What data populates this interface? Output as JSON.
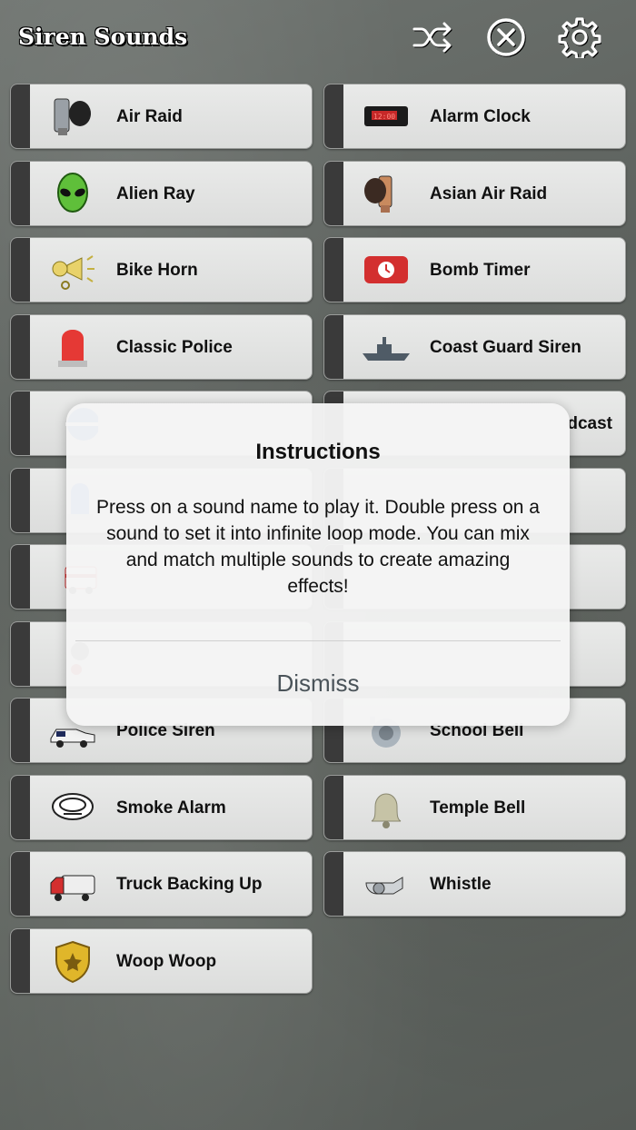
{
  "header": {
    "title": "Siren Sounds",
    "icons": [
      "shuffle-icon",
      "stop-circle-icon",
      "gear-icon"
    ]
  },
  "sounds": [
    {
      "label": "Air Raid",
      "icon": "air-raid-siren-icon"
    },
    {
      "label": "Alarm Clock",
      "icon": "alarm-clock-icon"
    },
    {
      "label": "Alien Ray",
      "icon": "alien-icon"
    },
    {
      "label": "Asian Air Raid",
      "icon": "asian-air-raid-icon"
    },
    {
      "label": "Bike Horn",
      "icon": "bike-horn-icon"
    },
    {
      "label": "Bomb Timer",
      "icon": "bomb-timer-icon"
    },
    {
      "label": "Classic Police",
      "icon": "police-light-icon"
    },
    {
      "label": "Coast Guard Siren",
      "icon": "ship-icon"
    },
    {
      "label": "",
      "icon": "partial-icon-1"
    },
    {
      "label": "dcast",
      "icon": ""
    },
    {
      "label": "",
      "icon": "blue-light-icon"
    },
    {
      "label": "",
      "icon": ""
    },
    {
      "label": "",
      "icon": "ambulance-icon"
    },
    {
      "label": "",
      "icon": ""
    },
    {
      "label": "",
      "icon": "partial-icon-4"
    },
    {
      "label": "",
      "icon": ""
    },
    {
      "label": "Police Siren",
      "icon": "police-car-icon"
    },
    {
      "label": "School Bell",
      "icon": "school-bell-icon"
    },
    {
      "label": "Smoke Alarm",
      "icon": "smoke-detector-icon"
    },
    {
      "label": "Temple Bell",
      "icon": "bell-icon"
    },
    {
      "label": "Truck Backing Up",
      "icon": "truck-icon"
    },
    {
      "label": "Whistle",
      "icon": "whistle-icon"
    },
    {
      "label": "Woop Woop",
      "icon": "badge-icon"
    }
  ],
  "dialog": {
    "title": "Instructions",
    "message": "Press on a sound name to play it. Double press on a sound to set it into infinite loop mode. You can mix and match multiple sounds to create amazing effects!",
    "button": "Dismiss"
  }
}
